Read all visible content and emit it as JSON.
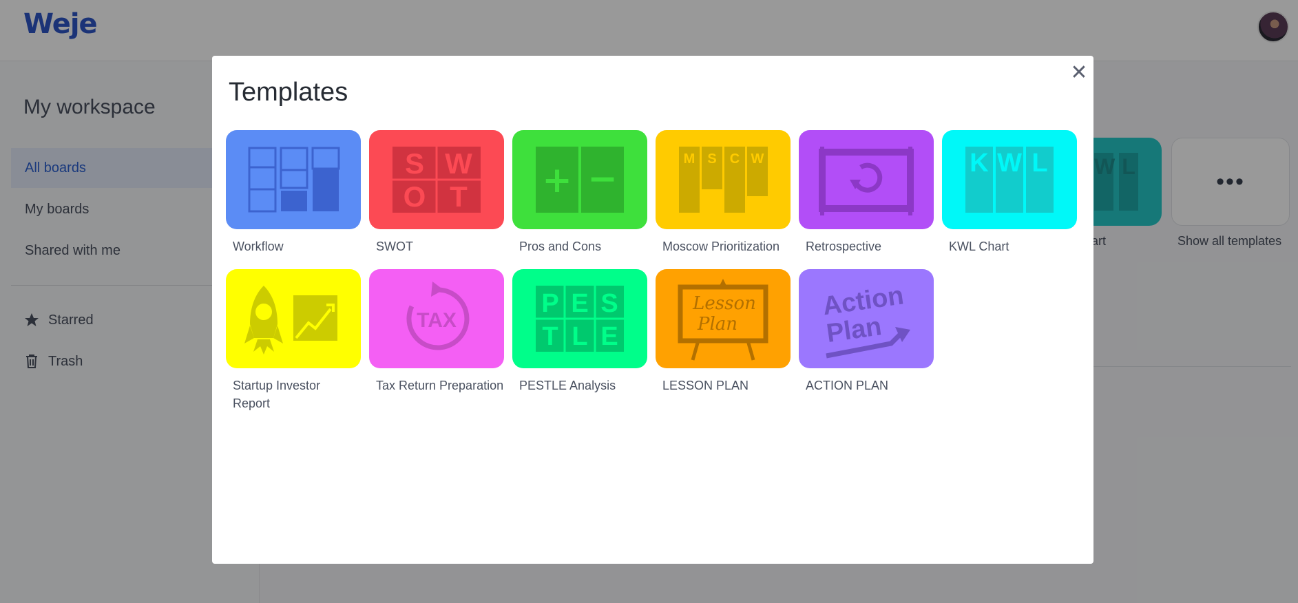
{
  "app": {
    "logo": "Weje"
  },
  "sidebar": {
    "title": "My workspace",
    "items": [
      {
        "label": "All boards",
        "active": true
      },
      {
        "label": "My boards"
      },
      {
        "label": "Shared with me"
      },
      {
        "label": "Starred",
        "icon": "star-icon"
      },
      {
        "label": "Trash",
        "icon": "trash-icon"
      }
    ]
  },
  "background_tiles": {
    "kwl_partial_label": "art",
    "kwl_letters": [
      "W",
      "L"
    ],
    "more_label": "Show all templates",
    "more_glyph": "•••"
  },
  "modal": {
    "title": "Templates",
    "close_glyph": "✕",
    "templates": [
      {
        "label": "Workflow",
        "color": "#5b8cf5"
      },
      {
        "label": "SWOT",
        "color": "#fc4a54",
        "letters": [
          "S",
          "W",
          "O",
          "T"
        ]
      },
      {
        "label": "Pros and Cons",
        "color": "#3ee03c",
        "letters": [
          "+",
          "−"
        ]
      },
      {
        "label": "Moscow Prioritization",
        "color": "#ffcb00",
        "letters": [
          "M",
          "S",
          "C",
          "W"
        ]
      },
      {
        "label": "Retrospective",
        "color": "#b24ef7"
      },
      {
        "label": "KWL Chart",
        "color": "#00f8f8",
        "letters": [
          "K",
          "W",
          "L"
        ]
      },
      {
        "label": "Startup Investor Report",
        "color": "#ffff00"
      },
      {
        "label": "Tax Return Preparation",
        "color": "#f45ff4",
        "letters": [
          "TAX"
        ]
      },
      {
        "label": "PESTLE Analysis",
        "color": "#00fe8a",
        "letters": [
          "P",
          "E",
          "S",
          "T",
          "L",
          "E"
        ]
      },
      {
        "label": "LESSON PLAN",
        "color": "#ffa101",
        "letters": [
          "Lesson",
          "Plan"
        ]
      },
      {
        "label": "ACTION PLAN",
        "color": "#9b77fe",
        "letters": [
          "Action",
          "Plan"
        ]
      }
    ]
  }
}
